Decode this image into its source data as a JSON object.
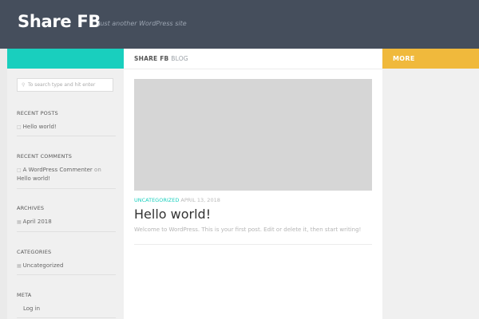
{
  "site": {
    "title": "Share FB",
    "tagline": "Just another WordPress site"
  },
  "nav": {
    "breadcrumb_site": "SHARE FB",
    "breadcrumb_section": "BLOG",
    "more_label": "MORE"
  },
  "search": {
    "placeholder": "To search type and hit enter"
  },
  "post": {
    "category": "UNCATEGORIZED",
    "date": "APRIL 13, 2018",
    "title": "Hello world!",
    "excerpt": "Welcome to WordPress. This is your first post. Edit or delete it, then start writing!"
  },
  "widgets": {
    "recent_posts": {
      "title": "RECENT POSTS",
      "items": [
        "Hello world!"
      ]
    },
    "recent_comments": {
      "title": "RECENT COMMENTS",
      "author": "A WordPress Commenter",
      "on": "on",
      "post": "Hello world!"
    },
    "archives": {
      "title": "ARCHIVES",
      "items": [
        "April 2018"
      ]
    },
    "categories": {
      "title": "CATEGORIES",
      "items": [
        "Uncategorized"
      ]
    },
    "meta": {
      "title": "META",
      "items": [
        "Log in"
      ]
    }
  },
  "colors": {
    "header_bg": "#454e5c",
    "accent_teal": "#19cfbe",
    "accent_yellow": "#f0b93c"
  },
  "icons": {
    "search": "search-icon",
    "post": "document-icon",
    "comment": "comment-icon",
    "archive": "folder-icon",
    "category": "folder-icon"
  }
}
